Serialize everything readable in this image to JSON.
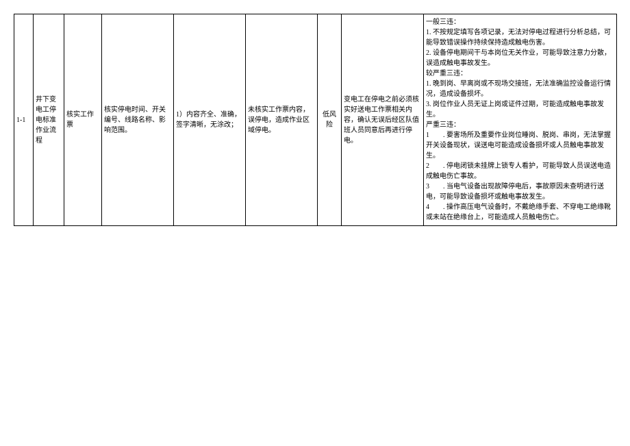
{
  "row": {
    "id": "1-1",
    "process": "井下变电工停电标准作业流程",
    "step": "核实工作票",
    "desc": "核实停电时间、开关编号、线路名称、影响范围。",
    "standard": "1）内容齐全、准确，签字清晰，无涂改；",
    "risk_desc": "未核实工作票内容，误停电，造成作业区域停电。",
    "risk_level": "低风险",
    "measure": "变电工在停电之前必须核实好送电工作票相关内容，确认无误后经区队值班人员同意后再进行停电。",
    "violation": {
      "section1_title": "一般三违：",
      "section1_items": [
        "1. 不按规定填写各项记录，无法对停电过程进行分析总结，可能导致错误操作持续保持造成触电伤害。",
        "2. 设备停电期间干与本岗位无关作业，可能导致注意力分散，误造成触电事故发生。"
      ],
      "section2_title": "较严重三违：",
      "section2_items": [
        "1. 晚到岗、早离岗或不现场交接班，无法准确监控设备运行情况，造成设备损坏。",
        "3. 岗位作业人员无证上岗或证件过期，可能造成触电事故发生。"
      ],
      "section3_title": "严重三违：",
      "section3_items": [
        "1　　. 要害场所及重要作业岗位睡岗、脱岗、串岗，无法掌握开关设备现状，误送电可能造成设备损坏或人员触电事故发生。",
        "2　　. 停电闭锁未挂牌上锁专人看护，可能导致人员误送电造成触电伤亡事故。",
        "3　　. 当电气设备出现故障停电后，事故原因未查明进行送电，可能导致设备损坏或触电事故发生。",
        "4　　. 操作高压电气设备时，不戴绝缘手套、不穿电工绝缘靴或未站在绝缘台上，可能造成人员触电伤亡。"
      ]
    }
  }
}
